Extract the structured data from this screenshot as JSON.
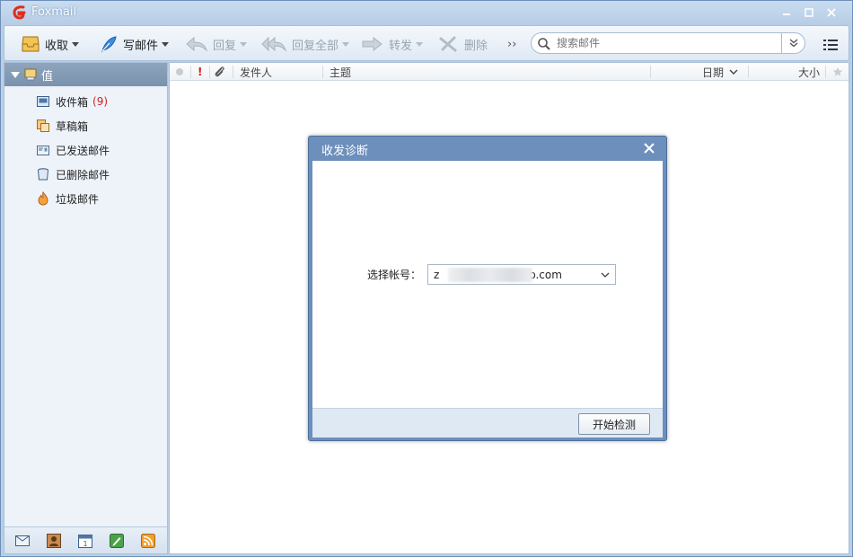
{
  "app": {
    "title": "Foxmail"
  },
  "toolbar": {
    "receive": "收取",
    "compose": "写邮件",
    "reply": "回复",
    "reply_all": "回复全部",
    "forward": "转发",
    "delete": "删除",
    "more": "››"
  },
  "search": {
    "placeholder": "搜索邮件"
  },
  "sidebar": {
    "account_name": "值",
    "folders": [
      {
        "label": "收件箱",
        "count": "(9)"
      },
      {
        "label": "草稿箱"
      },
      {
        "label": "已发送邮件"
      },
      {
        "label": "已删除邮件"
      },
      {
        "label": "垃圾邮件"
      }
    ]
  },
  "list_header": {
    "priority": "!",
    "sender": "发件人",
    "subject": "主题",
    "date": "日期",
    "size": "大小"
  },
  "dialog": {
    "title": "收发诊断",
    "account_label": "选择帐号：",
    "account_value_prefix": "z",
    "account_value_suffix": "o.com",
    "start_button": "开始检测"
  },
  "colors": {
    "titlebar": "#b7cde6",
    "dialog_frame": "#6c8fbc",
    "unread_count": "#d32020"
  }
}
